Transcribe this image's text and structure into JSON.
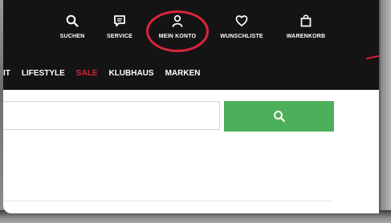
{
  "utility_nav": [
    {
      "label": "SUCHEN",
      "icon": "search-icon"
    },
    {
      "label": "SERVICE",
      "icon": "chat-icon"
    },
    {
      "label": "MEIN KONTO",
      "icon": "user-icon"
    },
    {
      "label": "WUNSCHLISTE",
      "icon": "heart-icon"
    },
    {
      "label": "WARENKORB",
      "icon": "bag-icon"
    }
  ],
  "main_nav": {
    "items": [
      "IT",
      "LIFESTYLE",
      "SALE",
      "KLUBHAUS",
      "MARKEN"
    ]
  },
  "search": {
    "value": "",
    "placeholder": "",
    "button_icon": "search-icon"
  },
  "colors": {
    "header_bg": "#141414",
    "sale_red": "#e0243a",
    "highlight_circle": "#d9253a",
    "search_button_green": "#4caf5a"
  }
}
